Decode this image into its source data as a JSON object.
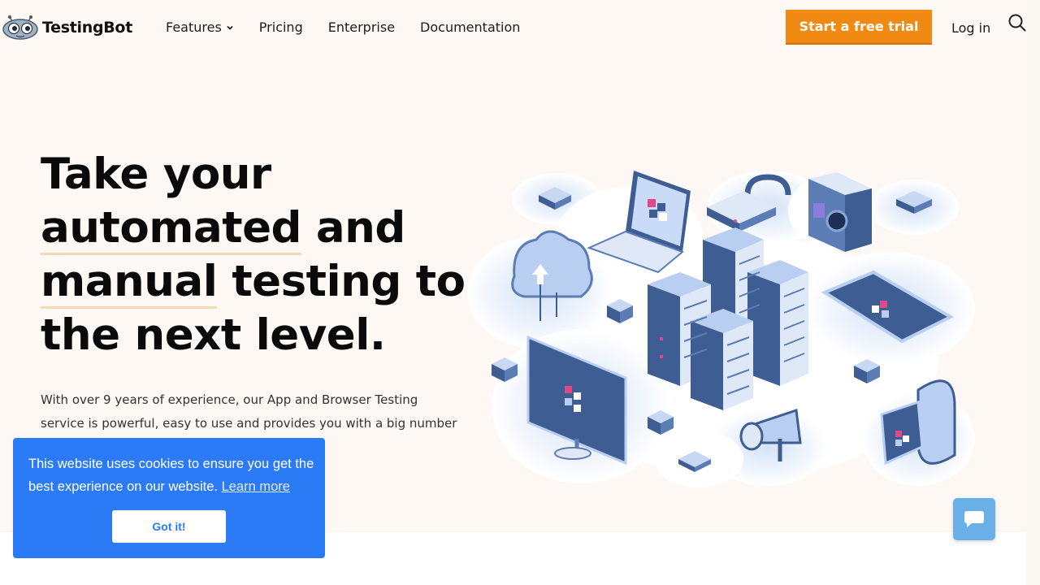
{
  "header": {
    "brand": "TestingBot",
    "nav": [
      {
        "label": "Features",
        "has_dropdown": true
      },
      {
        "label": "Pricing"
      },
      {
        "label": "Enterprise"
      },
      {
        "label": "Documentation"
      }
    ],
    "cta_label": "Start a free trial",
    "login_label": "Log in"
  },
  "hero": {
    "line1": "Take your",
    "line2_em": "automated",
    "line2_rest": " and",
    "line3_em": "manual",
    "line3_rest": " testing to",
    "line4": "the next level.",
    "subtitle": "With over 9 years of experience, our App and Browser Testing service is powerful, easy to use and provides you with a big number of features"
  },
  "cookie": {
    "message": "This website uses cookies to ensure you get the best experience on our website.",
    "link_label": "Learn more",
    "button_label": "Got it!"
  },
  "colors": {
    "accent": "#f08a12",
    "cookie_bg": "#2b7bf6",
    "hero_bg": "#fdf8f3",
    "chat_bg": "#6ab0e8"
  },
  "icons": {
    "logo": "robot-logo-icon",
    "features_caret": "chevron-down-icon",
    "search": "search-icon",
    "chat": "chat-bubble-icon"
  }
}
